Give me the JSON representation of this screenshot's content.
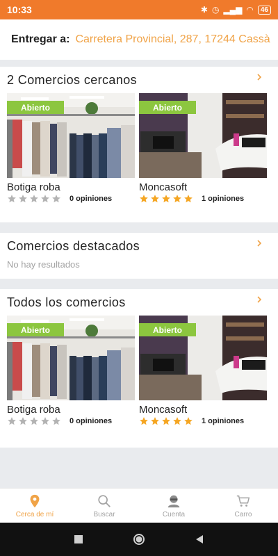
{
  "status_bar": {
    "time": "10:33",
    "battery": "46"
  },
  "delivery": {
    "label": "Entregar a:",
    "address": "Carretera Provincial, 287, 17244 Cassà"
  },
  "sections": {
    "nearby": {
      "title": "2 Comercios cercanos",
      "shops": [
        {
          "name": "Botiga roba",
          "status": "Abierto",
          "stars": 0,
          "reviews": "0 opiniones"
        },
        {
          "name": "Moncasoft",
          "status": "Abierto",
          "stars": 5,
          "reviews": "1 opiniones"
        }
      ]
    },
    "featured": {
      "title": "Comercios destacados",
      "empty_text": "No hay resultados"
    },
    "all": {
      "title": "Todos los comercios",
      "shops": [
        {
          "name": "Botiga roba",
          "status": "Abierto",
          "stars": 0,
          "reviews": "0 opiniones"
        },
        {
          "name": "Moncasoft",
          "status": "Abierto",
          "stars": 5,
          "reviews": "1 opiniones"
        }
      ]
    }
  },
  "tabbar": {
    "tabs": [
      {
        "label": "Cerca de mí",
        "icon": "location-pin-icon",
        "active": true
      },
      {
        "label": "Buscar",
        "icon": "search-icon",
        "active": false
      },
      {
        "label": "Cuenta",
        "icon": "user-icon",
        "active": false
      },
      {
        "label": "Carro",
        "icon": "cart-icon",
        "active": false
      }
    ]
  },
  "colors": {
    "accent": "#f07a2b",
    "address": "#f0a347",
    "open_badge": "#8cc63f",
    "star_filled": "#f5a623",
    "star_empty": "#b3b3b3"
  }
}
